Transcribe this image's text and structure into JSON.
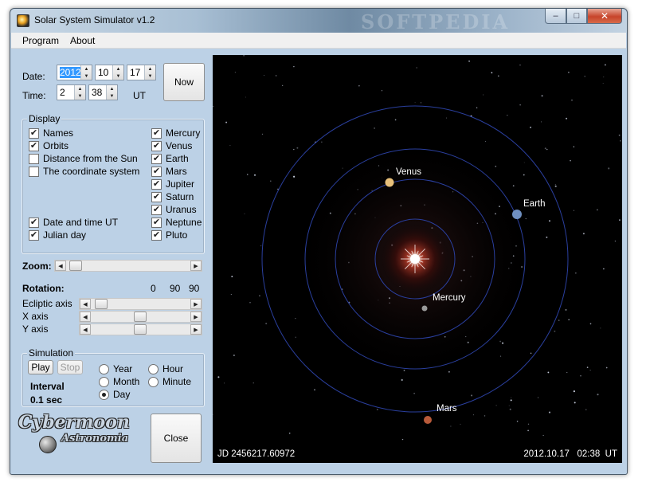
{
  "window": {
    "title": "Solar System Simulator v1.2",
    "watermark": "SOFTPEDIA"
  },
  "window_buttons": {
    "minimize": "–",
    "maximize": "□",
    "close": "✕"
  },
  "menu": {
    "items": [
      "Program",
      "About"
    ]
  },
  "datetime": {
    "date_label": "Date:",
    "year": "2012",
    "month": "10",
    "day": "17",
    "time_label": "Time:",
    "hour": "2",
    "minute": "38",
    "tz": "UT",
    "now_button": "Now"
  },
  "display": {
    "title": "Display",
    "left": [
      {
        "label": "Names",
        "checked": true
      },
      {
        "label": "Orbits",
        "checked": true
      },
      {
        "label": "Distance from the Sun",
        "checked": false
      },
      {
        "label": "The coordinate system",
        "checked": false
      },
      {
        "label": "Date and time UT",
        "checked": true
      },
      {
        "label": "Julian day",
        "checked": true
      }
    ],
    "planets": [
      {
        "label": "Mercury",
        "checked": true
      },
      {
        "label": "Venus",
        "checked": true
      },
      {
        "label": "Earth",
        "checked": true
      },
      {
        "label": "Mars",
        "checked": true
      },
      {
        "label": "Jupiter",
        "checked": true
      },
      {
        "label": "Saturn",
        "checked": true
      },
      {
        "label": "Uranus",
        "checked": true
      },
      {
        "label": "Neptune",
        "checked": true
      },
      {
        "label": "Pluto",
        "checked": true
      }
    ]
  },
  "zoom": {
    "label": "Zoom:",
    "value": 0.03
  },
  "rotation": {
    "label": "Rotation:",
    "values": [
      "0",
      "90",
      "90"
    ],
    "ecliptic_label": "Ecliptic axis",
    "ecliptic_value": 0.05,
    "x_label": "X axis",
    "x_value": 0.5,
    "y_label": "Y axis",
    "y_value": 0.5
  },
  "simulation": {
    "title": "Simulation",
    "play": "Play",
    "stop": "Stop",
    "interval_label": "Interval",
    "interval_value": "0.1 sec",
    "options": [
      {
        "label": "Year",
        "selected": false
      },
      {
        "label": "Hour",
        "selected": false
      },
      {
        "label": "Month",
        "selected": false
      },
      {
        "label": "Minute",
        "selected": false
      },
      {
        "label": "Day",
        "selected": true
      }
    ]
  },
  "logo": {
    "main": "Cybermoon",
    "sub": "Astronomia"
  },
  "close_button": "Close",
  "view": {
    "jd": "JD 2456217.60972",
    "datetime": "2012.10.17   02:38  UT",
    "planets": [
      {
        "name": "Mercury",
        "color": "#9a9a9a"
      },
      {
        "name": "Venus",
        "color": "#e8c07a"
      },
      {
        "name": "Earth",
        "color": "#6f8fc0"
      },
      {
        "name": "Mars",
        "color": "#b85a3a"
      }
    ],
    "orbit_color": "#2a3f9e"
  }
}
